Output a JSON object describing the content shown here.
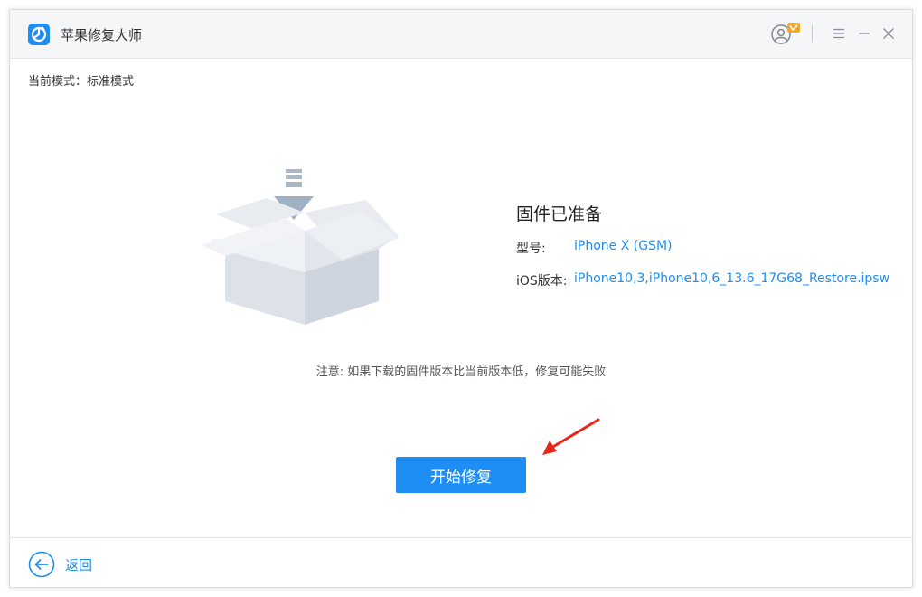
{
  "app": {
    "title": "苹果修复大师"
  },
  "mode": {
    "text": "当前模式：标准模式"
  },
  "firmware": {
    "title": "固件已准备",
    "model_label": "型号:",
    "model_value": "iPhone X (GSM)",
    "ios_label": "iOS版本:",
    "ios_value": "iPhone10,3,iPhone10,6_13.6_17G68_Restore.ipsw"
  },
  "note": {
    "text": "注意: 如果下载的固件版本比当前版本低，修复可能失败"
  },
  "actions": {
    "start_label": "开始修复"
  },
  "footer": {
    "back_label": "返回"
  },
  "icons": {
    "logo": "app-logo-icon",
    "user": "user-account-icon",
    "badge": "vip-badge-icon",
    "menu": "menu-icon",
    "minimize": "minimize-icon",
    "close": "close-icon",
    "box": "open-box-download-icon",
    "annotation": "red-arrow-icon",
    "back": "back-arrow-icon"
  },
  "colors": {
    "accent": "#1f8ef4",
    "link": "#1e8ef0",
    "annotation": "#e8271c",
    "titlebar": "#f5f6f8"
  }
}
